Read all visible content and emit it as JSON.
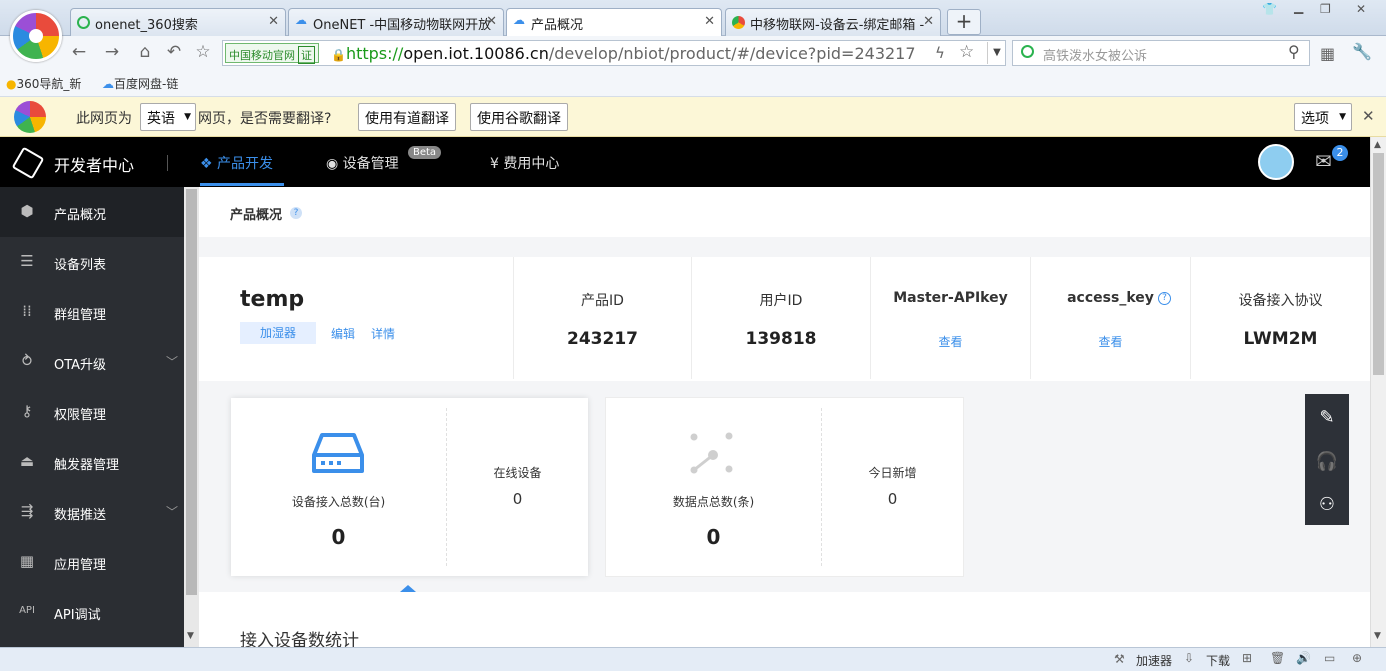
{
  "browser": {
    "tabs": [
      {
        "title": "onenet_360搜索",
        "icon_color": "#2bb34f"
      },
      {
        "title": "OneNET -中国移动物联网开放",
        "icon_color": "#3b8fea"
      },
      {
        "title": "产品概况",
        "icon_color": "#3b8fea"
      },
      {
        "title": "中移物联网-设备云-绑定邮箱 -",
        "icon_color": "#e94b3c"
      }
    ],
    "new_tab": "+",
    "official_label": "中国移动官网",
    "official_badge": "证",
    "url_scheme": "https://",
    "url_host": "open.iot.10086.cn",
    "url_path": "/develop/nbiot/product/#/device?pid=243217",
    "search_placeholder": "高铁泼水女被公诉",
    "bookmarks": [
      "360导航_新",
      "百度网盘-链"
    ]
  },
  "translate_bar": {
    "prefix": "此网页为",
    "language": "英语",
    "suffix": "网页，是否需要翻译?",
    "youdao_btn": "使用有道翻译",
    "google_btn": "使用谷歌翻译",
    "options_btn": "选项"
  },
  "header": {
    "title": "开发者中心",
    "nav": [
      {
        "label": "产品开发",
        "active": true
      },
      {
        "label": "设备管理",
        "badge": "Beta"
      },
      {
        "label": "费用中心"
      }
    ],
    "mail_count": "2"
  },
  "sidebar": {
    "items": [
      {
        "label": "产品概况",
        "icon": "cube-icon",
        "active": true
      },
      {
        "label": "设备列表",
        "icon": "list-icon"
      },
      {
        "label": "群组管理",
        "icon": "grid-dots-icon"
      },
      {
        "label": "OTA升级",
        "icon": "ota-icon",
        "chevron": true
      },
      {
        "label": "权限管理",
        "icon": "key-icon"
      },
      {
        "label": "触发器管理",
        "icon": "trigger-icon"
      },
      {
        "label": "数据推送",
        "icon": "push-icon",
        "chevron": true
      },
      {
        "label": "应用管理",
        "icon": "apps-icon"
      },
      {
        "label": "API调试",
        "icon": "api-icon"
      }
    ]
  },
  "page": {
    "title": "产品概况",
    "help": "?",
    "product": {
      "name": "temp",
      "tag": "加湿器",
      "edit": "编辑",
      "detail": "详情"
    },
    "info": {
      "product_id_label": "产品ID",
      "product_id": "243217",
      "user_id_label": "用户ID",
      "user_id": "139818",
      "master_key_label": "Master-APIkey",
      "master_key_link": "查看",
      "access_key_label": "access_key",
      "access_key_link": "查看",
      "protocol_label": "设备接入协议",
      "protocol": "LWM2M"
    },
    "stats": {
      "device_total_label": "设备接入总数(台)",
      "device_total": "0",
      "online_label": "在线设备",
      "online": "0",
      "datapoint_label": "数据点总数(条)",
      "datapoint_total": "0",
      "today_label": "今日新增",
      "today": "0"
    },
    "section_title": "接入设备数统计"
  },
  "statusbar": {
    "accelerator": "加速器",
    "download": "下载"
  },
  "colors": {
    "accent": "#3b8fea",
    "header_bg": "#000000",
    "sidebar_bg": "#2b2e33"
  }
}
